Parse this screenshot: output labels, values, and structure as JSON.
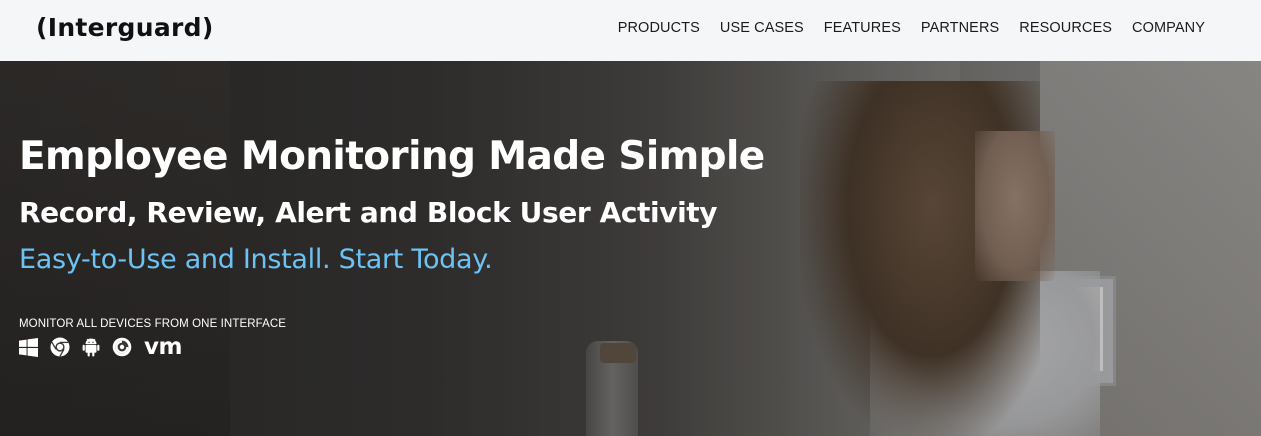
{
  "header": {
    "logo": "(Interguard)",
    "nav": [
      "PRODUCTS",
      "USE CASES",
      "FEATURES",
      "PARTNERS",
      "RESOURCES",
      "COMPANY"
    ]
  },
  "hero": {
    "headline": "Employee Monitoring Made Simple",
    "subheadline": "Record, Review, Alert and Block User Activity",
    "tagline": "Easy-to-Use and Install. Start Today.",
    "devices_label": "MONITOR ALL DEVICES FROM ONE INTERFACE",
    "device_icons": [
      "windows-icon",
      "chrome-icon",
      "android-icon",
      "macos-icon",
      "vmware-icon"
    ],
    "vm_text": "vm"
  },
  "colors": {
    "tagline": "#6cc3f3",
    "header_bg": "#f5f6f8"
  }
}
